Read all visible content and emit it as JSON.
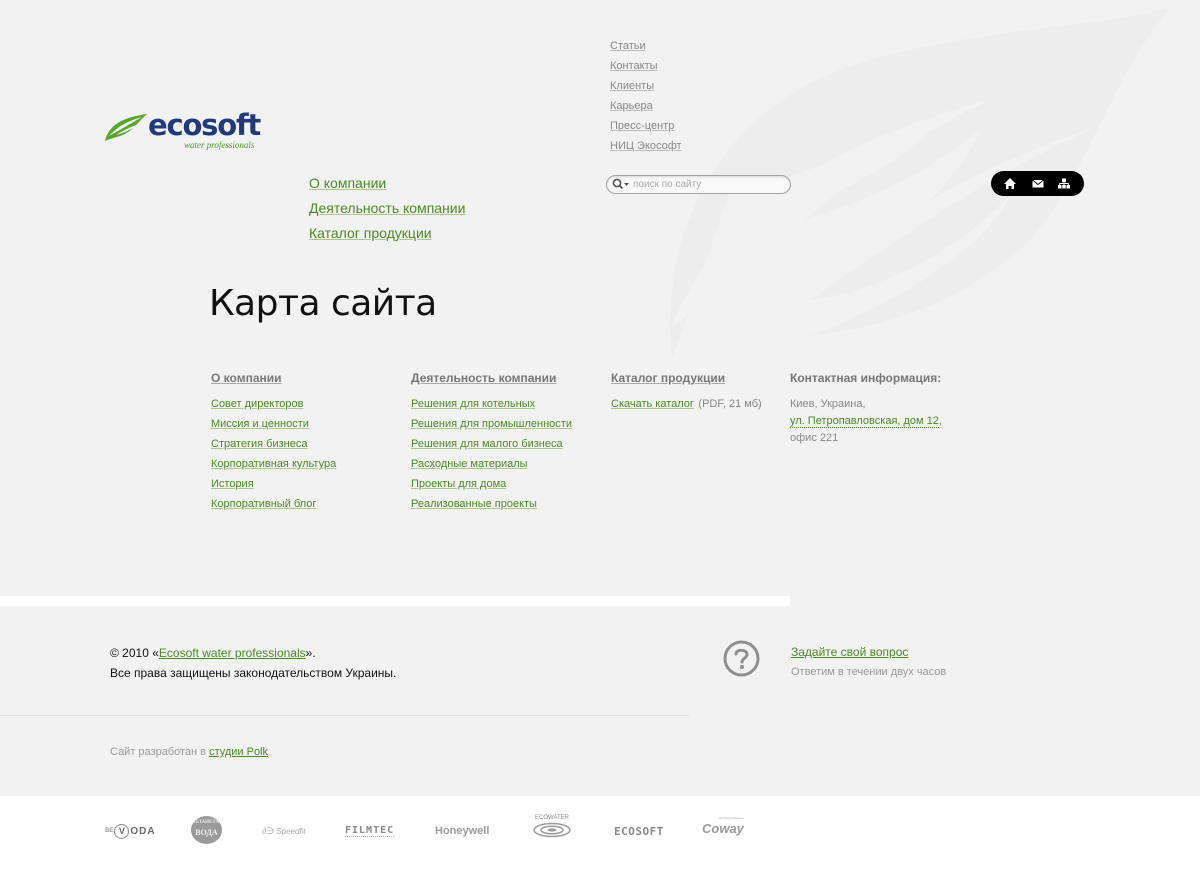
{
  "logo": {
    "wordmark": "ecosoft",
    "tagline": "water professionals"
  },
  "top_links": [
    {
      "label": "Статьи"
    },
    {
      "label": "Контакты"
    },
    {
      "label": "Клиенты"
    },
    {
      "label": "Карьера"
    },
    {
      "label": "Пресс-центр"
    },
    {
      "label": "НИЦ Экософт"
    }
  ],
  "main_nav": [
    {
      "label": "О компании"
    },
    {
      "label": "Деятельность компании"
    },
    {
      "label": "Каталог продукции"
    }
  ],
  "search": {
    "placeholder": "поиск по сайту",
    "value": "",
    "icon": "search-icon"
  },
  "icon_bar": {
    "icons": [
      "home-icon",
      "mail-icon",
      "sitemap-icon"
    ],
    "background": "#000000"
  },
  "page_title": "Карта сайта",
  "sitemap": {
    "about": {
      "heading": "О компании",
      "items": [
        "Совет директоров",
        "Миссия и ценности",
        "Стратегия бизнеса",
        "Корпоративная культура",
        "История",
        "Корпоративный блог"
      ]
    },
    "activity": {
      "heading": "Деятельность компании",
      "items": [
        "Решения для котельных",
        "Решения для промышленности",
        "Решения для малого бизнеса",
        "Расходные материалы",
        "Проекты для дома",
        "Реализованные проекты"
      ]
    },
    "catalog": {
      "heading": "Каталог продукции",
      "download_label": "Скачать каталог",
      "download_note": "(PDF, 21 мб)"
    },
    "contact": {
      "heading": "Контактная информация:",
      "city": "Киев, Украина,",
      "address": "ул. Петропавловская, дом 12",
      "address_suffix": ",",
      "office": "офис 221"
    }
  },
  "footer": {
    "copyright_prefix": "© 2010 «",
    "copyright_link": "Ecosoft water professionals",
    "copyright_suffix": "».",
    "rights": "Все права защищены законодательством Украины.",
    "ask_link": "Задайте свой вопрос",
    "ask_note": "Ответим в течении двух часов",
    "dev_prefix": "Сайт разработан в ",
    "dev_link": "студии Polk"
  },
  "partners": [
    {
      "name": "VODA",
      "prefix": "ВЕ",
      "circle_letter": "V",
      "rest": "ODA"
    },
    {
      "name": "ПЛАНЕТА ВОДА",
      "line1": "ПЛАНЕТА",
      "line2": "ВОДА"
    },
    {
      "name": "Speedfit",
      "label": "Speedfit"
    },
    {
      "name": "FILMTEC",
      "label": "FILMTEC"
    },
    {
      "name": "Honeywell",
      "label": "Honeywell"
    },
    {
      "name": "ECOWATER",
      "label": "ECOWATER"
    },
    {
      "name": "ECOSOFT",
      "label": "ECOSOFT"
    },
    {
      "name": "Coway",
      "label": "Coway",
      "small": "We Bring Wellness"
    }
  ],
  "colors": {
    "background": "#f2f2f2",
    "link_green": "#4b8a24",
    "logo_blue": "#233a7a",
    "logo_green": "#5aa52b",
    "muted_text": "#888888"
  }
}
